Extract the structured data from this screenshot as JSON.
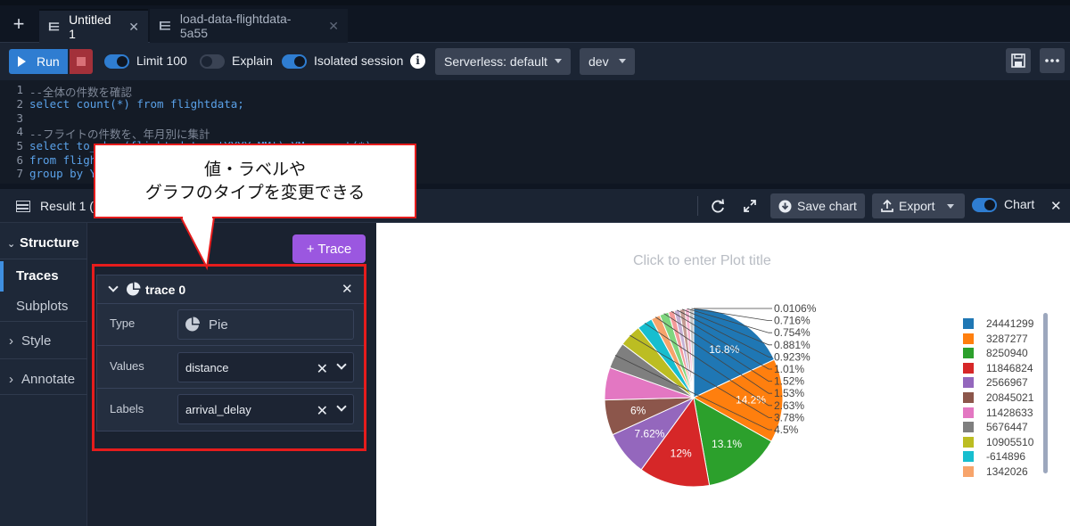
{
  "tabs": [
    {
      "label": "Untitled 1",
      "active": true
    },
    {
      "label": "load-data-flightdata-5a55",
      "active": false
    }
  ],
  "toolbar": {
    "run_label": "Run",
    "limit_label": "Limit 100",
    "limit_on": true,
    "explain_label": "Explain",
    "explain_on": false,
    "isolated_label": "Isolated session",
    "isolated_on": true,
    "workgroup": "Serverless: default",
    "database": "dev"
  },
  "editor": {
    "lines": [
      {
        "n": "1",
        "text": "--全体の件数を確認"
      },
      {
        "n": "2",
        "text": "select count(*) from flightdata;"
      },
      {
        "n": "3",
        "text": ""
      },
      {
        "n": "4",
        "text": "--フライトの件数を、年月別に集計"
      },
      {
        "n": "5",
        "text": "select to_char(flight_date, 'YYYY-MM') YM, count(*)"
      },
      {
        "n": "6",
        "text": "from flightdata"
      },
      {
        "n": "7",
        "text": "group by YM"
      }
    ]
  },
  "result": {
    "title": "Result 1 (",
    "save_chart": "Save chart",
    "export": "Export",
    "chart_label": "Chart",
    "chart_on": true
  },
  "nav": {
    "structure": "Structure",
    "traces": "Traces",
    "subplots": "Subplots",
    "style": "Style",
    "annotate": "Annotate"
  },
  "trace_panel": {
    "add_trace": "+ Trace",
    "trace_name": "trace 0",
    "type_label": "Type",
    "type_value": "Pie",
    "values_label": "Values",
    "values_value": "distance",
    "labels_label": "Labels",
    "labels_value": "arrival_delay"
  },
  "callout": {
    "line1": "値・ラベルや",
    "line2": "グラフのタイプを変更できる"
  },
  "plot": {
    "title_placeholder": "Click to enter Plot title"
  },
  "chart_data": {
    "type": "pie",
    "title": "",
    "labels": [
      "24441299",
      "3287277",
      "8250940",
      "11846824",
      "2566967",
      "20845021",
      "11428633",
      "5676447",
      "10905510",
      "-614896",
      "1342026"
    ],
    "values": [
      16.8,
      14.2,
      13.1,
      12,
      7.62,
      6,
      5.5,
      4.5,
      3.78,
      2.63,
      1.53,
      1.52,
      1.01,
      0.923,
      0.881,
      0.754,
      0.716,
      0.0106
    ],
    "colors": [
      "#1f77b4",
      "#ff7f0e",
      "#2ca02c",
      "#d62728",
      "#9467bd",
      "#8c564b",
      "#e377c2",
      "#7f7f7f",
      "#bcbd22",
      "#17becf",
      "#f7a46b",
      "#7fd67f",
      "#f49a9a",
      "#c5b0d5",
      "#c49c94",
      "#f7b6d2",
      "#c7c7c7",
      "#dbdb8d"
    ],
    "slice_labels": [
      "16.8%",
      "14.2%",
      "13.1%",
      "12%",
      "7.62%",
      "6%",
      "",
      "4.5%",
      "3.78%",
      "2.63%",
      "1.53%",
      "1.52%",
      "1.01%",
      "0.923%",
      "0.881%",
      "0.754%",
      "0.716%",
      "0.0106%"
    ],
    "legend_position": "right"
  }
}
